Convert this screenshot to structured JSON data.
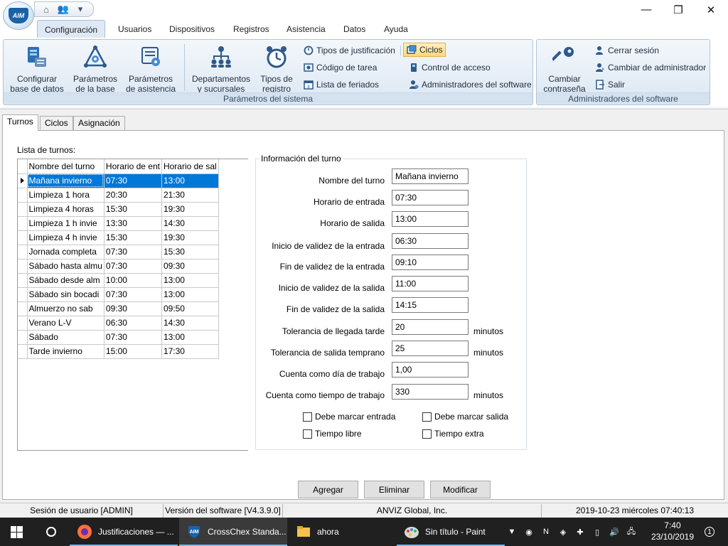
{
  "window": {
    "minimize": "—",
    "maximize": "❐",
    "close": "✕",
    "logo_text": "AIM"
  },
  "ribbon_tabs": [
    "Configuración",
    "Usuarios",
    "Dispositivos",
    "Registros",
    "Asistencia",
    "Datos",
    "Ayuda"
  ],
  "ribbon": {
    "system_group_label": "Parámetros del sistema",
    "software_group_label": "Administradores del software",
    "btn_db": "Configurar\nbase de datos",
    "btn_base": "Parámetros\nde la base",
    "btn_attendance": "Parámetros\nde asistencia",
    "btn_departments": "Departamentos\ny sucursales",
    "btn_record_types": "Tipos de\nregistro",
    "btn_justification_types": "Tipos de justificación",
    "btn_task_code": "Código de tarea",
    "btn_holidays": "Lista de feriados",
    "btn_cycles": "Ciclos",
    "btn_access_control": "Control de acceso",
    "btn_software_admins": "Administradores del software",
    "btn_change_password": "Cambiar\ncontraseña",
    "btn_logout": "Cerrar sesión",
    "btn_change_admin": "Cambiar de administrador",
    "btn_exit": "Salir"
  },
  "inner_tabs": [
    "Turnos",
    "Ciclos",
    "Asignación"
  ],
  "shift_list": {
    "label": "Lista de turnos:",
    "columns": [
      "Nombre del turno",
      "Horario de ent",
      "Horario de sal"
    ],
    "rows": [
      [
        "Mañana invierno",
        "07:30",
        "13:00"
      ],
      [
        "Limpieza 1 hora",
        "20:30",
        "21:30"
      ],
      [
        "Limpieza 4 horas",
        "15:30",
        "19:30"
      ],
      [
        "Limpieza 1 h invie",
        "13:30",
        "14:30"
      ],
      [
        "Limpieza 4 h invie",
        "15:30",
        "19:30"
      ],
      [
        "Jornada completa",
        "07:30",
        "15:30"
      ],
      [
        "Sábado hasta almu",
        "07:30",
        "09:30"
      ],
      [
        "Sábado desde alm",
        "10:00",
        "13:00"
      ],
      [
        "Sábado sin bocadi",
        "07:30",
        "13:00"
      ],
      [
        "Almuerzo no sab",
        "09:30",
        "09:50"
      ],
      [
        "Verano L-V",
        "06:30",
        "14:30"
      ],
      [
        "Sábado",
        "07:30",
        "13:00"
      ],
      [
        "Tarde invierno",
        "15:00",
        "17:30"
      ]
    ]
  },
  "shift_info": {
    "title": "Información del turno",
    "fields": [
      {
        "label": "Nombre del turno",
        "value": "Mañana invierno",
        "unit": ""
      },
      {
        "label": "Horario de entrada",
        "value": "07:30",
        "unit": ""
      },
      {
        "label": "Horario de salida",
        "value": "13:00",
        "unit": ""
      },
      {
        "label": "Inicio de validez de la entrada",
        "value": "06:30",
        "unit": ""
      },
      {
        "label": "Fin de validez de la entrada",
        "value": "09:10",
        "unit": ""
      },
      {
        "label": "Inicio de validez de la salida",
        "value": "11:00",
        "unit": ""
      },
      {
        "label": "Fin de validez de la salida",
        "value": "14:15",
        "unit": ""
      },
      {
        "label": "Tolerancia de llegada tarde",
        "value": "20",
        "unit": "minutos"
      },
      {
        "label": "Tolerancia de salida temprano",
        "value": "25",
        "unit": "minutos"
      },
      {
        "label": "Cuenta como día de trabajo",
        "value": "1,00",
        "unit": ""
      },
      {
        "label": "Cuenta como tiempo de trabajo",
        "value": "330",
        "unit": "minutos"
      }
    ],
    "checkboxes": [
      "Debe marcar entrada",
      "Debe marcar salida",
      "Tiempo libre",
      "Tiempo extra"
    ]
  },
  "actions": {
    "add": "Agregar",
    "delete": "Eliminar",
    "modify": "Modificar"
  },
  "statusbar": {
    "session": "Sesión de usuario  [ADMIN]",
    "version": "Versión del software  [V4.3.9.0]",
    "company": "ANVIZ Global, Inc.",
    "datetime": "2019-10-23 miércoles 07:40:13"
  },
  "taskbar": {
    "items": [
      "Justificaciones — ...",
      "CrossChex Standa...",
      "ahora",
      "Sin título - Paint"
    ],
    "time": "7:40",
    "date": "23/10/2019",
    "notification_count": "1"
  },
  "colors": {
    "selection": "#0078d7",
    "taskbar": "#202020",
    "ribbon_group": "#dce7f3"
  }
}
